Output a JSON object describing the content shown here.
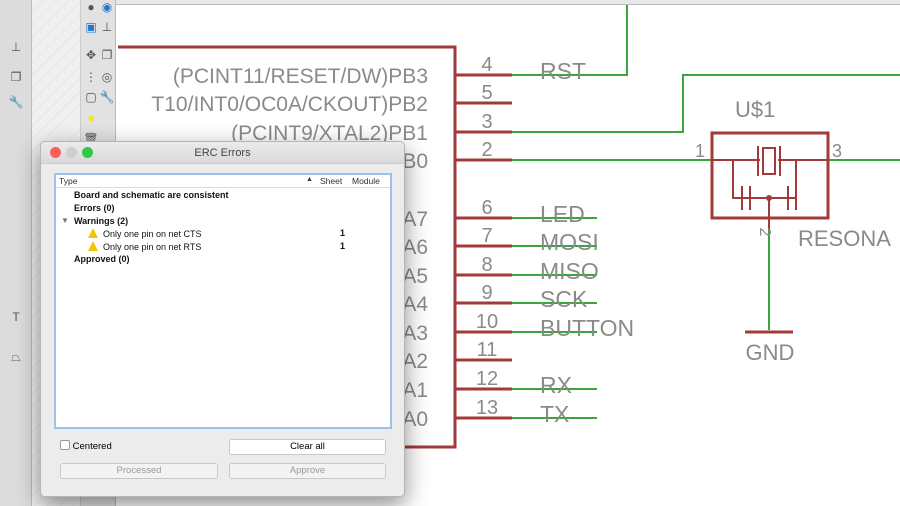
{
  "schematic": {
    "part_pins": [
      {
        "num": "4",
        "label": "(PCINT11/RESET/DW)PB3",
        "net": "RST"
      },
      {
        "num": "5",
        "label": "T10/INT0/OC0A/CKOUT)PB2",
        "net": ""
      },
      {
        "num": "3",
        "label": "(PCINT9/XTAL2)PB1",
        "net": ""
      },
      {
        "num": "2",
        "label": "B0",
        "net": ""
      },
      {
        "num": "6",
        "label": "A7",
        "net": "LED"
      },
      {
        "num": "7",
        "label": "A6",
        "net": "MOSI"
      },
      {
        "num": "8",
        "label": "A5",
        "net": "MISO"
      },
      {
        "num": "9",
        "label": "A4",
        "net": "SCK"
      },
      {
        "num": "10",
        "label": "A3",
        "net": "BUTTON"
      },
      {
        "num": "11",
        "label": "A2",
        "net": ""
      },
      {
        "num": "12",
        "label": "A1",
        "net": "RX"
      },
      {
        "num": "13",
        "label": "A0",
        "net": "TX"
      }
    ],
    "resonator": {
      "name": "U$1",
      "value": "RESONA",
      "pin1": "1",
      "pin2": "2",
      "pin3": "3",
      "gnd": "GND"
    },
    "colors": {
      "part": "#a23a3a",
      "wire": "#3aa53a",
      "text": "#8a8a8a"
    }
  },
  "dialog": {
    "title": "ERC Errors",
    "columns": [
      "Type",
      "Sheet",
      "Module"
    ],
    "rows": [
      {
        "text": "Board and schematic are consistent"
      },
      {
        "text": "Errors (0)"
      },
      {
        "text": "Warnings (2)",
        "expanded": true
      },
      {
        "text": "Only one pin on net CTS",
        "sheet": "1",
        "icon": "warning-icon"
      },
      {
        "text": "Only one pin on net RTS",
        "sheet": "1",
        "icon": "warning-icon"
      },
      {
        "text": "Approved (0)"
      }
    ],
    "centered_label": "Centered",
    "centered_checked": false,
    "clear_all": "Clear all",
    "processed": "Processed",
    "approve": "Approve"
  }
}
